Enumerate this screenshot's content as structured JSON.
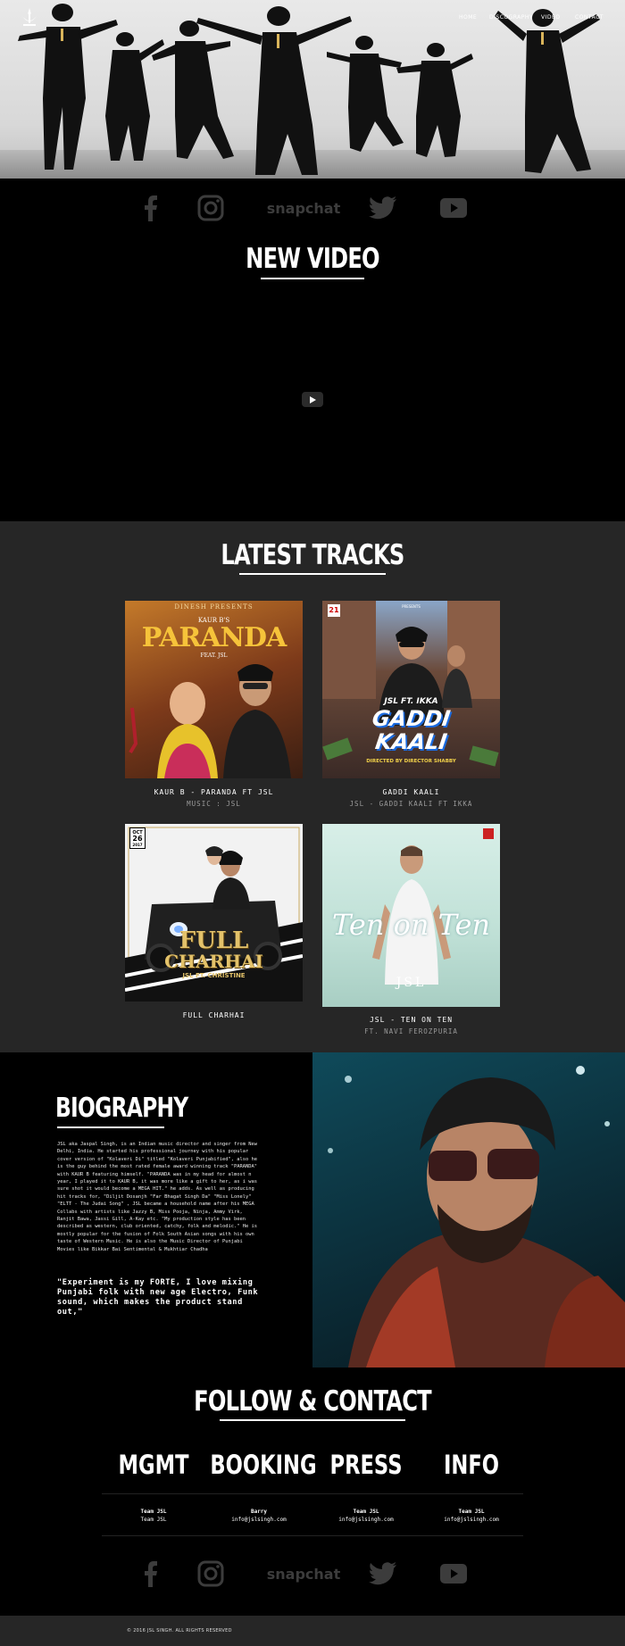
{
  "brand": {
    "logo_icon": "emblem-logo-icon"
  },
  "nav": {
    "items": [
      "HOME",
      "DISCOGRAPHY",
      "VIDEO",
      "CONTACT"
    ]
  },
  "social": {
    "snapchat_label": "snapchat",
    "icons": [
      "facebook-icon",
      "instagram-icon",
      "snapchat-wordmark",
      "twitter-icon",
      "youtube-icon"
    ]
  },
  "new_video": {
    "title": "NEW VIDEO",
    "play_icon": "play-icon"
  },
  "latest_tracks": {
    "title": "LATEST TRACKS",
    "tracks": [
      {
        "title": "KAUR B - PARANDA FT JSL",
        "subtitle": "MUSIC : JSL",
        "cover": {
          "top_text": "DINESH PRESENTS",
          "artist": "KAUR B'S",
          "name": "PARANDA",
          "feat": "FEAT. JSL"
        }
      },
      {
        "title": "GADDI KAALI",
        "subtitle": "JSL - GADDI KAALI FT IKKA",
        "cover": {
          "top_text": "PRESENTS",
          "line1": "JSL FT. IKKA",
          "name1": "GADDI",
          "name2": "KAALI",
          "credit": "DIRECTED BY DIRECTOR SHABBY",
          "badge": "21"
        }
      },
      {
        "title": "FULL CHARHAI",
        "subtitle": "",
        "cover": {
          "badge_top": "OCT",
          "badge_num": "26",
          "badge_year": "2017",
          "name1": "FULL",
          "name2": "CHARHAI",
          "feat": "JSL FT. CHRISTINE"
        }
      },
      {
        "title": "JSL - TEN ON TEN",
        "subtitle": "FT. NAVI FEROZPURIA",
        "cover": {
          "script": "Ten on Ten",
          "artist": "JSL"
        }
      }
    ]
  },
  "biography": {
    "title": "BIOGRAPHY",
    "body": "JSL aka Jaspal Singh, is an Indian music director and singer from New Delhi, India. He started his professional journey with his popular cover version of \"Kolaveri Di\" titled \"Kolaveri Punjabified\", also he is the guy behind the most rated female award winning track \"PARANDA\" with KAUR B featuring himself. \"PARANDA was in my head for almost n year, I played it to KAUR B, it was more like a gift to her, as i was sure shot it would become a MEGA HIT.\" he adds. As well as producing hit tracks for, \"Diljit Dosanjh \"Far Bhagat Singh Da\" \"Miss Lonely\" \"ELTT - The Judai Song\" , JSL became a household name after his MEGA Collabs with artists like Jazzy B, Miss Pooja, Ninja, Ammy Virk, Ranjit Bawa, Jassi Gill, A-Kay etc. \"My production style has been described as western, club oriented, catchy, folk and melodic.\" He is mostly popular for the fusion of Folk South Asian songs with his own taste of Western Music. He is also the Music Director of Punjabi Movies like Bikkar Bai Sentimental & Mukhtiar Chadha",
    "quote": "\"Experiment is my FORTE, I love mixing Punjabi folk with new age Electro, Funk sound, which makes the product stand out,\""
  },
  "contact": {
    "title": "FOLLOW & CONTACT",
    "columns": [
      {
        "heading": "MGMT",
        "name": "Team JSL",
        "detail": "Team JSL"
      },
      {
        "heading": "BOOKING",
        "name": "Barry",
        "detail": "info@jslsingh.com"
      },
      {
        "heading": "PRESS",
        "name": "Team JSL",
        "detail": "info@jslsingh.com"
      },
      {
        "heading": "INFO",
        "name": "Team JSL",
        "detail": "info@jslsingh.com"
      }
    ]
  },
  "footer": {
    "text": "© 2016 JSL SINGH. ALL RIGHTS RESERVED"
  }
}
